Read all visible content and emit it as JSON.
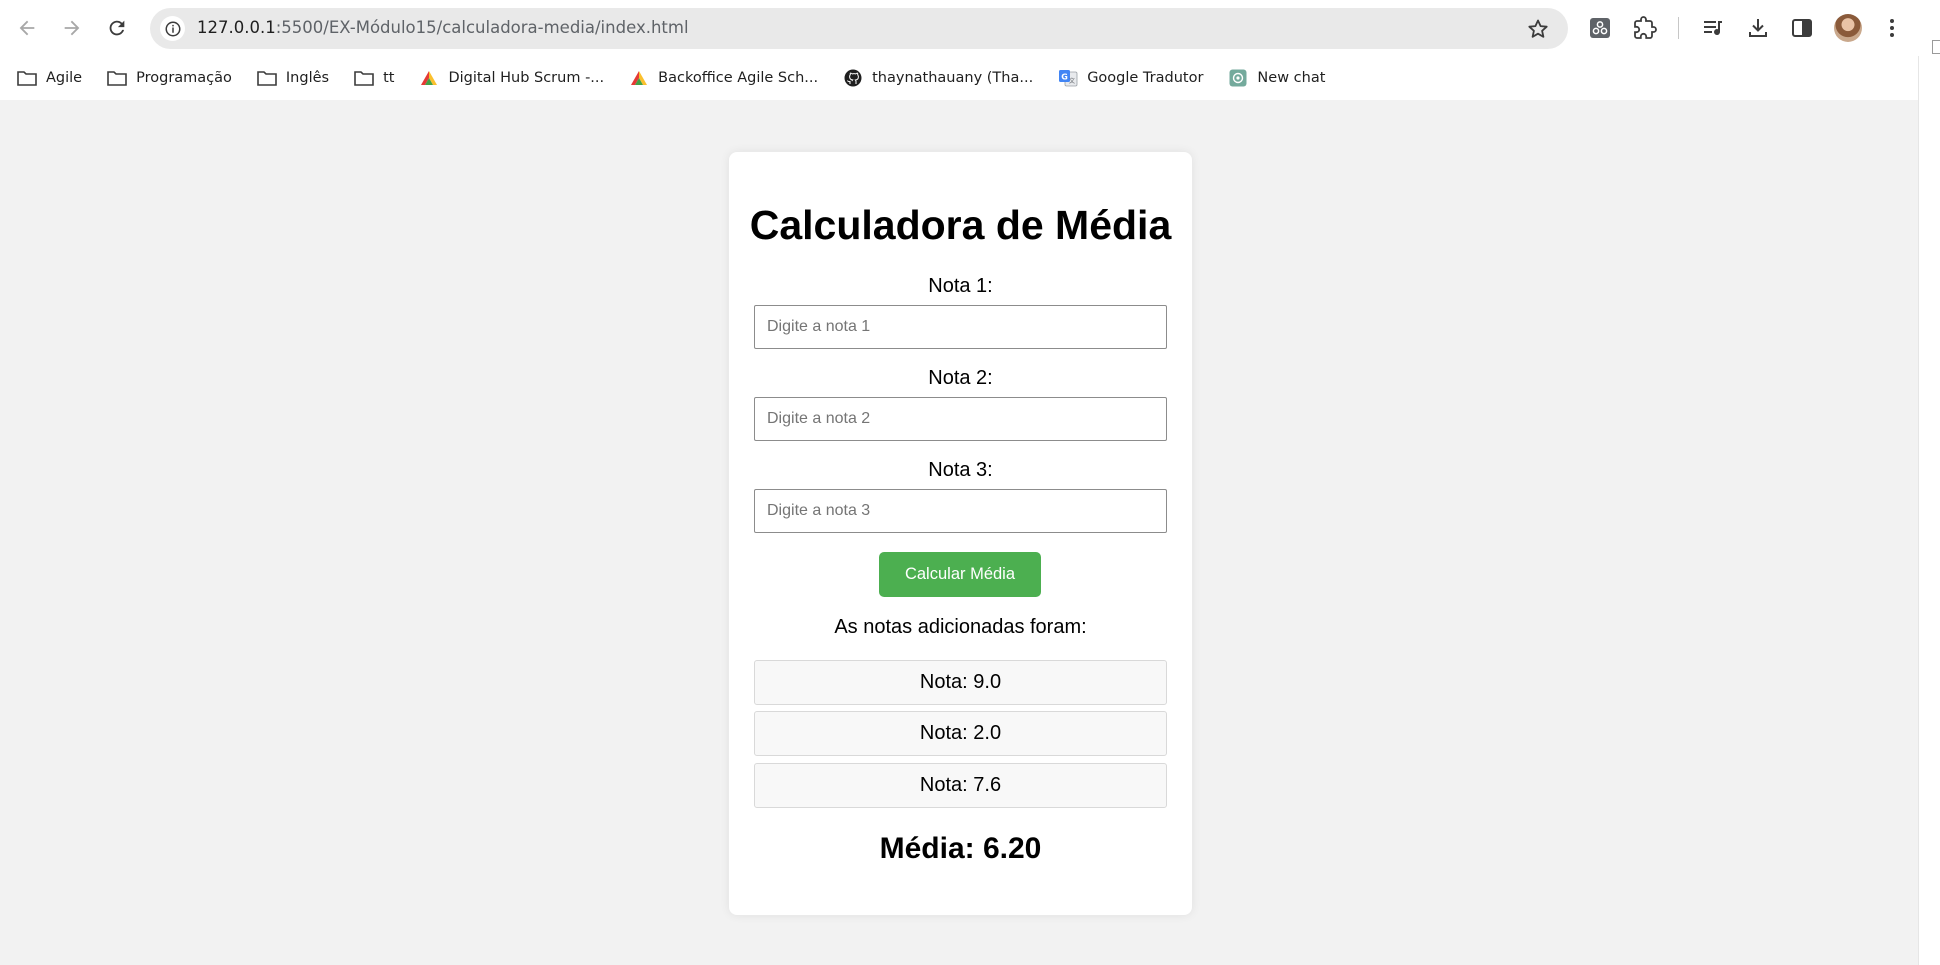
{
  "browser": {
    "url_host": "127.0.0.1",
    "url_path": ":5500/EX-Módulo15/calculadora-media/index.html"
  },
  "bookmarks": [
    {
      "label": "Agile",
      "icon": "folder-icon"
    },
    {
      "label": "Programação",
      "icon": "folder-icon"
    },
    {
      "label": "Inglês",
      "icon": "folder-icon"
    },
    {
      "label": "tt",
      "icon": "folder-icon"
    },
    {
      "label": "Digital Hub Scrum -...",
      "icon": "agile-logo-icon"
    },
    {
      "label": "Backoffice Agile Sch...",
      "icon": "agile-logo-icon"
    },
    {
      "label": "thaynathauany (Tha...",
      "icon": "github-icon"
    },
    {
      "label": "Google Tradutor",
      "icon": "google-translate-icon"
    },
    {
      "label": "New chat",
      "icon": "chatgpt-icon"
    }
  ],
  "app": {
    "title": "Calculadora de Média",
    "fields": [
      {
        "label": "Nota 1:",
        "placeholder": "Digite a nota 1"
      },
      {
        "label": "Nota 2:",
        "placeholder": "Digite a nota 2"
      },
      {
        "label": "Nota 3:",
        "placeholder": "Digite a nota 3"
      }
    ],
    "button_label": "Calcular Média",
    "notas_heading": "As notas adicionadas foram:",
    "notas": [
      "Nota: 9.0",
      "Nota: 2.0",
      "Nota: 7.6"
    ],
    "media": "Média: 6.20"
  },
  "colors": {
    "button": "#4caf50",
    "page_background": "#f2f2f2",
    "card_background": "#ffffff"
  }
}
